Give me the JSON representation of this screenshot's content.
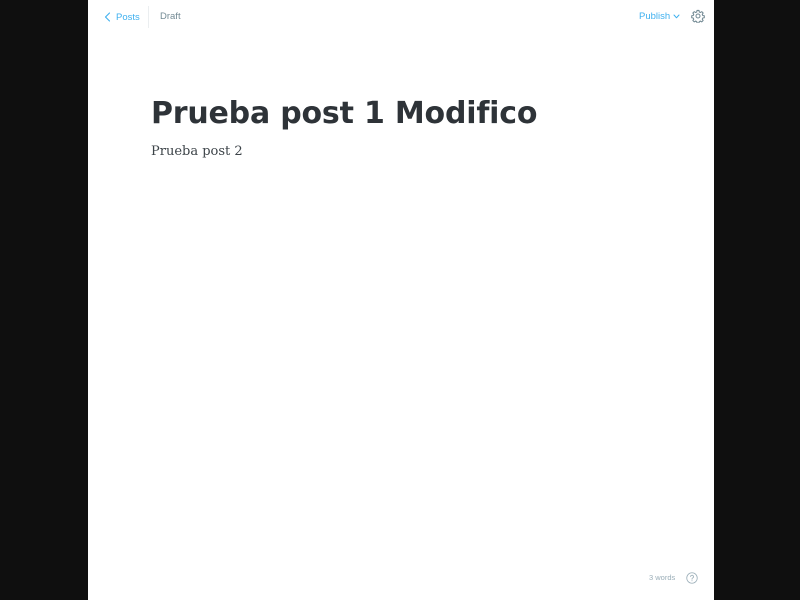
{
  "header": {
    "back_label": "Posts",
    "status": "Draft",
    "publish_label": "Publish"
  },
  "post": {
    "title": "Prueba post 1 Modifico",
    "body": "Prueba post 2"
  },
  "footer": {
    "word_count": "3 words"
  },
  "icons": {
    "back": "chevron-left-icon",
    "publish_dropdown": "chevron-down-icon",
    "settings": "gear-icon",
    "help": "question-circle-icon"
  },
  "colors": {
    "accent": "#3eb0ef",
    "muted": "#738a94",
    "title": "#2e3338",
    "background": "#0f0f0f"
  }
}
